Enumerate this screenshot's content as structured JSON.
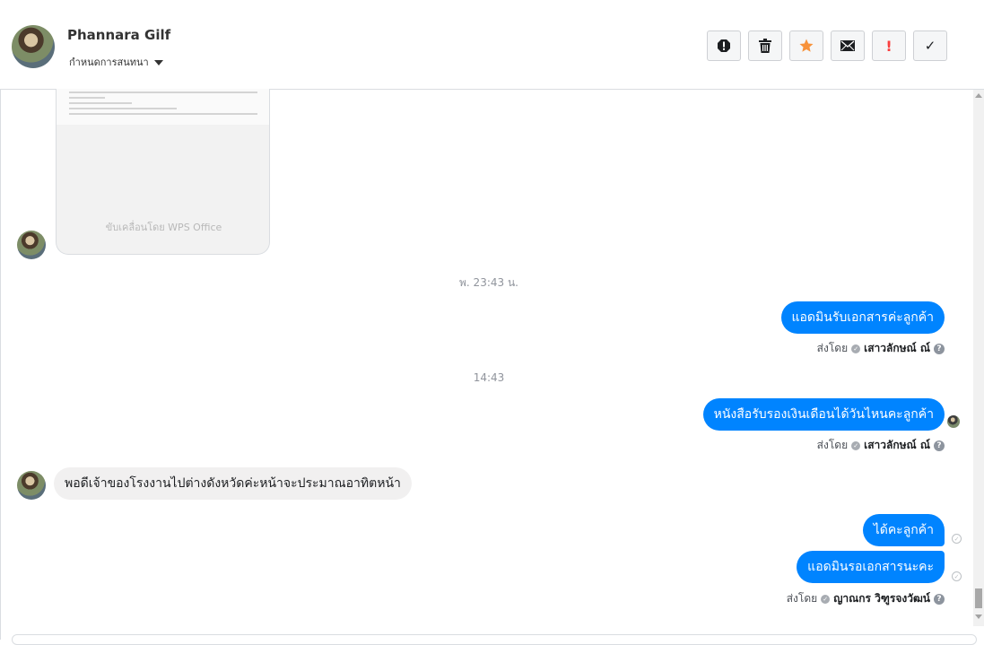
{
  "header": {
    "contact_name": "Phannara Gilf",
    "subtitle": "กำหนดการสนทนา",
    "actions": [
      {
        "icon": "exclamation-circle-icon",
        "label": "!"
      },
      {
        "icon": "trash-icon",
        "label": ""
      },
      {
        "icon": "star-icon",
        "label": "★",
        "color": "#f7923b"
      },
      {
        "icon": "envelope-icon",
        "label": ""
      },
      {
        "icon": "exclamation-icon",
        "label": "!",
        "color": "#fa3e3e"
      },
      {
        "icon": "check-icon",
        "label": "✓"
      }
    ]
  },
  "attachment": {
    "footer_text": "ขับเคลื่อนโดย WPS Office"
  },
  "timestamps": {
    "first": "พ. 23:43 น.",
    "second": "14:43"
  },
  "messages": [
    {
      "direction": "out",
      "text": "แอดมินรับเอกสารค่ะลูกค้า",
      "sent_by_label": "ส่งโดย",
      "sender": "เสาวลักษณ์ ณ์"
    },
    {
      "direction": "out",
      "text": "หนังสือรับรองเงินเดือนได้วันไหนคะลูกค้า",
      "sent_by_label": "ส่งโดย",
      "sender": "เสาวลักษณ์ ณ์"
    },
    {
      "direction": "in",
      "text": "พอดีเจ้าของโรงงานไปต่างดังหวัดค่ะหน้าจะประมาณอาทิตหน้า"
    },
    {
      "direction": "out",
      "text": "ได้คะลูกค้า"
    },
    {
      "direction": "out",
      "text": "แอดมินรอเอกสารนะคะ",
      "sent_by_label": "ส่งโดย",
      "sender": "ญาณกร วิฑูรจงวัฒน์"
    }
  ],
  "colors": {
    "outgoing_bubble": "#0084ff",
    "incoming_bubble": "#f1f0f0",
    "timestamp": "#90949c"
  }
}
